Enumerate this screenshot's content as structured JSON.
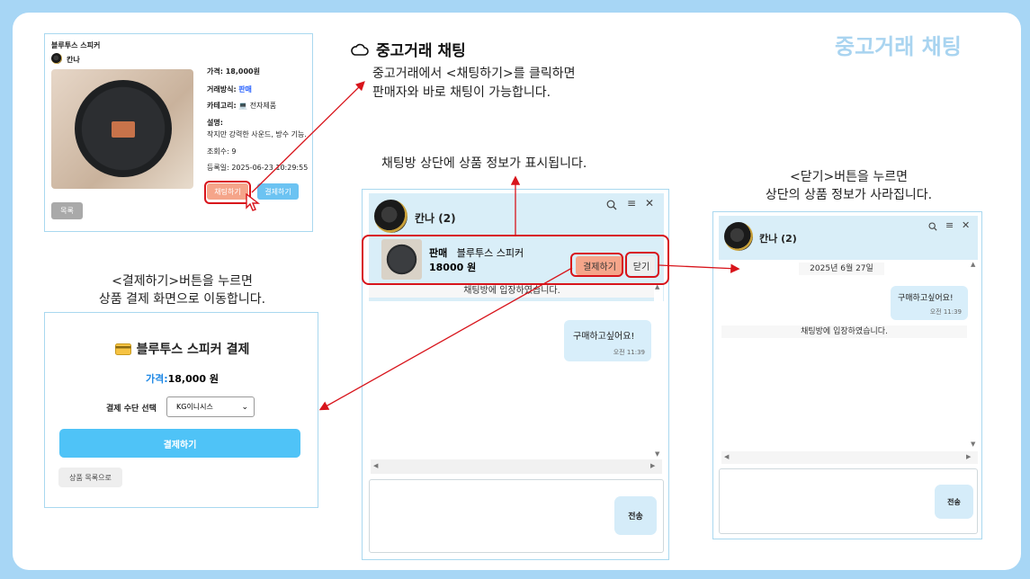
{
  "slide_title": "중고거래 채팅",
  "section": {
    "icon": "cloud-icon",
    "title": "중고거래 채팅",
    "desc_line1": "중고거래에서 <채팅하기>를 클릭하면",
    "desc_line2": "판매자와 바로 채팅이 가능합니다."
  },
  "product_card": {
    "title": "블루투스 스피커",
    "seller": "칸나",
    "price": "가격: 18,000원",
    "trade_label": "거래방식:",
    "trade_value": "판매",
    "category_label": "카테고리:",
    "category_value": "💻 전자제품",
    "desc_label": "설명:",
    "desc_value": "작지만 강력한 사운드, 방수 기능.",
    "views": "조회수: 9",
    "date": "등록일: 2025-06-23 10:29:55",
    "chat_button": "채팅하기",
    "pay_button": "결제하기",
    "list_button": "목록"
  },
  "captions": {
    "chat_header_info": "채팅방 상단에 상품 정보가 표시됩니다.",
    "close_line1": "<닫기>버튼을 누르면",
    "close_line2": "상단의 상품 정보가 사라집니다.",
    "pay_line1": "<결제하기>버튼을 누르면",
    "pay_line2": "상품 결제 화면으로 이동합니다."
  },
  "payment": {
    "title": "블루투스 스피커 결제",
    "price_label": "가격:",
    "price_value": "18,000 원",
    "method_label": "결제 수단 선택",
    "method_selected": "KG이니시스",
    "pay_button": "결제하기",
    "back_button": "상품 목록으로"
  },
  "chat_main": {
    "user": "칸나 (2)",
    "product_status": "판매",
    "product_name": "블루투스 스피커",
    "product_price": "18000 원",
    "pay_button": "결제하기",
    "close_button": "닫기",
    "system_msg": "채팅방에 입장하였습니다.",
    "message": "구매하고싶어요!",
    "time": "오전 11:39",
    "send_button": "전송"
  },
  "chat_closed": {
    "user": "칸나 (2)",
    "date": "2025년 6월 27일",
    "message": "구매하고싶어요!",
    "time": "오전 11:39",
    "system_msg": "채팅방에 입장하였습니다.",
    "send_button": "전송"
  },
  "colors": {
    "accent": "#4fc3f7",
    "highlight": "#d8141b",
    "orange": "#f5a58a",
    "slide_bg": "#a7d6f5"
  }
}
